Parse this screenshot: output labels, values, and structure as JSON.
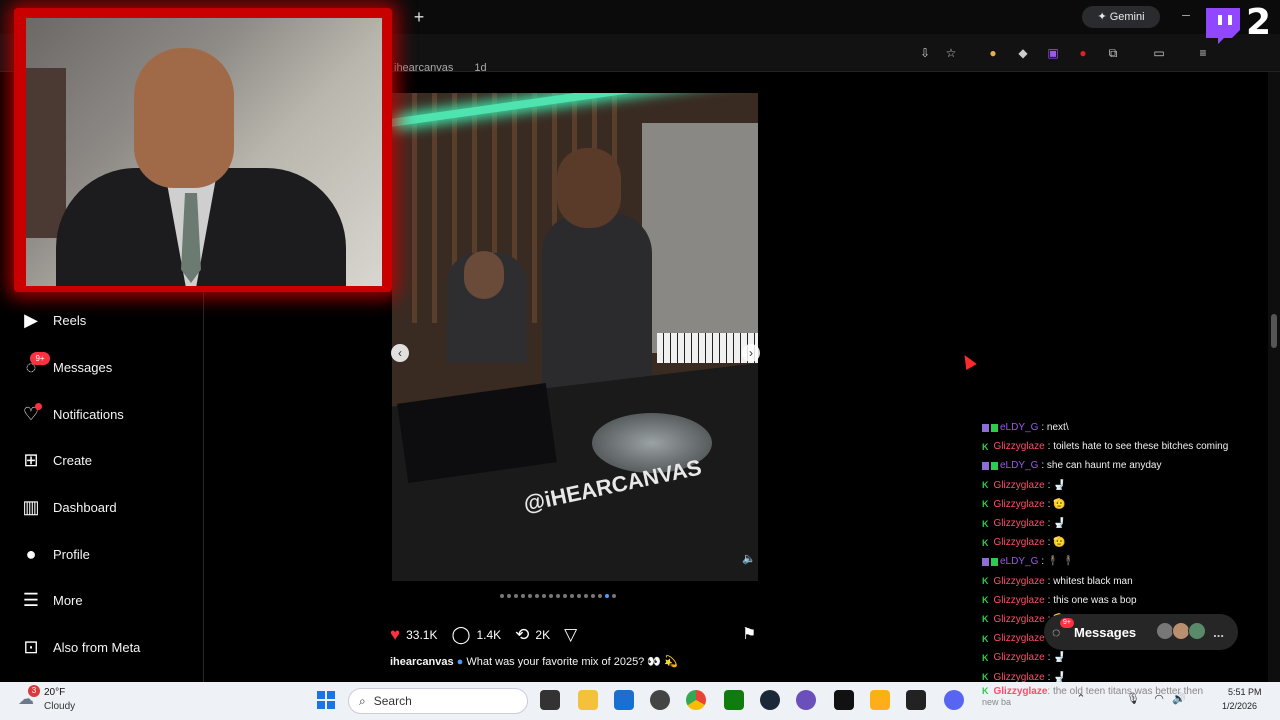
{
  "browser": {
    "new_tab": "+",
    "gemini_label": "Gemini",
    "minimize": "–"
  },
  "stream_overlay": {
    "twitch_counter": "2"
  },
  "post": {
    "username_partial": "ihearcanvas",
    "time_partial": "1d",
    "media_text": "@iHEARCANVAS",
    "likes": "33.1K",
    "comments": "1.4K",
    "reposts": "2K",
    "caption_user": "ihearcanvas",
    "caption_text": "What was your favorite mix of 2025? 👀 💫",
    "slide_count": 17,
    "active_slide": 15
  },
  "sidebar": {
    "items": [
      {
        "label": "Reels",
        "icon": "reels-icon"
      },
      {
        "label": "Messages",
        "icon": "messenger-icon"
      },
      {
        "label": "Notifications",
        "icon": "heart-icon"
      },
      {
        "label": "Create",
        "icon": "plus-square-icon"
      },
      {
        "label": "Dashboard",
        "icon": "chart-icon"
      },
      {
        "label": "Profile",
        "icon": "profile-icon"
      },
      {
        "label": "More",
        "icon": "hamburger-icon"
      },
      {
        "label": "Also from Meta",
        "icon": "meta-grid-icon"
      }
    ],
    "messages_badge": "9+"
  },
  "chat": [
    {
      "user": "eLDY_G",
      "color": "purple",
      "badges": "mod",
      "msg": ": next\\"
    },
    {
      "user": "Glizzyglaze",
      "color": "red",
      "badges": "k",
      "msg": ": toilets hate to see these bitches coming"
    },
    {
      "user": "eLDY_G",
      "color": "purple",
      "badges": "mod",
      "msg": ": she can haunt me anyday"
    },
    {
      "user": "Glizzyglaze",
      "color": "red",
      "badges": "k",
      "msg": ": 🚽"
    },
    {
      "user": "Glizzyglaze",
      "color": "red",
      "badges": "k",
      "msg": ": 🫡"
    },
    {
      "user": "Glizzyglaze",
      "color": "red",
      "badges": "k",
      "msg": ": 🚽"
    },
    {
      "user": "Glizzyglaze",
      "color": "red",
      "badges": "k",
      "msg": ": 🫡"
    },
    {
      "user": "eLDY_G",
      "color": "purple",
      "badges": "mod",
      "msg": ": 🕴 🕴"
    },
    {
      "user": "Glizzyglaze",
      "color": "red",
      "badges": "k",
      "msg": ": whitest black man"
    },
    {
      "user": "Glizzyglaze",
      "color": "red",
      "badges": "k",
      "msg": ": this one was a bop"
    },
    {
      "user": "Glizzyglaze",
      "color": "red",
      "badges": "k",
      "msg": ": 🫡"
    },
    {
      "user": "Glizzyglaze",
      "color": "red",
      "badges": "k",
      "msg": ": 🚽"
    },
    {
      "user": "Glizzyglaze",
      "color": "red",
      "badges": "k",
      "msg": ": 🚽"
    },
    {
      "user": "Glizzyglaze",
      "color": "red",
      "badges": "k",
      "msg": ": 🚽"
    }
  ],
  "chat_bottom": {
    "user": "Glizzyglaze",
    "msg": ": the old teen titans was better then",
    "cont": "new ba"
  },
  "messages_pill": {
    "label": "Messages",
    "badge": "9+",
    "more": "..."
  },
  "taskbar": {
    "weather_temp": "20°F",
    "weather_desc": "Cloudy",
    "weather_badge": "3",
    "search_placeholder": "Search",
    "time": "5:51 PM",
    "date": "1/2/2026"
  },
  "colors": {
    "accent_red": "#c90000",
    "like_red": "#ff3040",
    "chat_purple": "#9b59f0",
    "chat_red": "#ff4c6a",
    "link_blue": "#4a9dff"
  }
}
